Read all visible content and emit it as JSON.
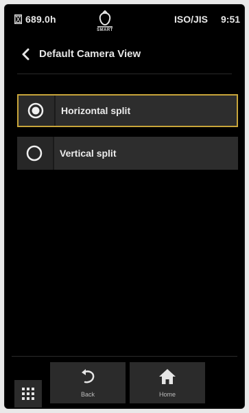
{
  "status_bar": {
    "hours": "689.0h",
    "logo_text": "SMART",
    "standard": "ISO/JIS",
    "time": "9:51"
  },
  "header": {
    "title": "Default Camera View"
  },
  "options": [
    {
      "label": "Horizontal split",
      "selected": true
    },
    {
      "label": "Vertical split",
      "selected": false
    }
  ],
  "bottom_nav": {
    "back_label": "Back",
    "home_label": "Home"
  },
  "colors": {
    "accent_selected_border": "#c8a53a",
    "background": "#000000",
    "option_background": "#2d2d2d"
  },
  "icons": {
    "hourglass": "hourglass-icon",
    "logo": "smart-logo-icon",
    "back": "chevron-left-icon",
    "radio_selected": "radio-selected-icon",
    "radio_unselected": "radio-unselected-icon",
    "undo": "undo-arrow-icon",
    "home": "home-icon",
    "grid": "grid-menu-icon"
  }
}
